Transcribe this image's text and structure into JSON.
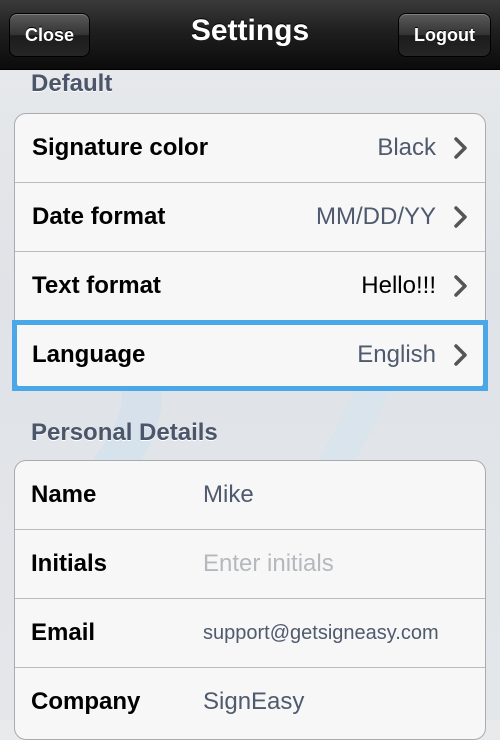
{
  "navbar": {
    "title": "Settings",
    "close_label": "Close",
    "logout_label": "Logout"
  },
  "sections": {
    "default_header": "Default",
    "personal_header": "Personal Details"
  },
  "default_rows": [
    {
      "label": "Signature color",
      "value": "Black"
    },
    {
      "label": "Date format",
      "value": "MM/DD/YY"
    },
    {
      "label": "Text format",
      "value": "Hello!!!"
    },
    {
      "label": "Language",
      "value": "English"
    }
  ],
  "personal_rows": [
    {
      "label": "Name",
      "value": "Mike",
      "placeholder": ""
    },
    {
      "label": "Initials",
      "value": "",
      "placeholder": "Enter initials"
    },
    {
      "label": "Email",
      "value": "support@getsigneasy.com",
      "placeholder": ""
    },
    {
      "label": "Company",
      "value": "SignEasy",
      "placeholder": ""
    }
  ],
  "colors": {
    "highlight": "#4aa8e8",
    "section_header": "#4c566a",
    "value_text": "#4f5a6e"
  },
  "icons": {
    "row_disclosure": "chevron-right-icon"
  }
}
